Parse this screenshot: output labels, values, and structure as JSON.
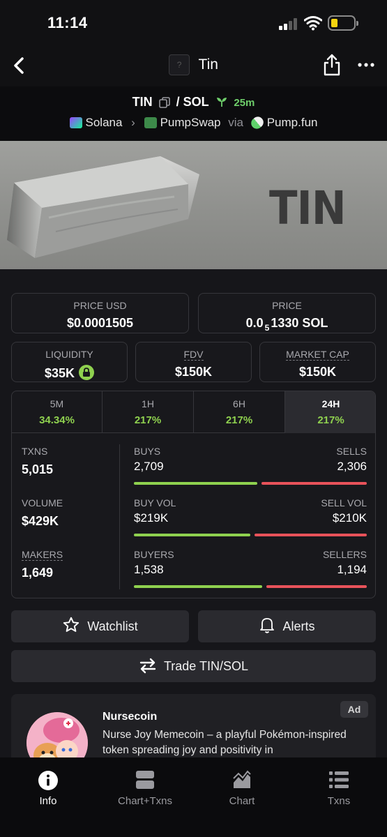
{
  "status_bar": {
    "time": "11:14"
  },
  "nav": {
    "token_icon": "?",
    "title": "Tin"
  },
  "pair": {
    "base": "TIN",
    "separator": "/",
    "quote": "SOL",
    "age": "25m",
    "chain": "Solana",
    "dex": "PumpSwap",
    "via": "via",
    "launchpad": "Pump.fun"
  },
  "banner": {
    "text": "TIN"
  },
  "price_usd": {
    "label": "PRICE USD",
    "value": "$0.0001505"
  },
  "price": {
    "label": "PRICE",
    "prefix": "0.0",
    "zeros": "5",
    "suffix": "1330 SOL"
  },
  "liquidity": {
    "label": "LIQUIDITY",
    "value": "$35K"
  },
  "fdv": {
    "label": "FDV",
    "value": "$150K"
  },
  "market_cap": {
    "label": "MARKET CAP",
    "value": "$150K"
  },
  "timeframes": [
    {
      "label": "5M",
      "change": "34.34%"
    },
    {
      "label": "1H",
      "change": "217%"
    },
    {
      "label": "6H",
      "change": "217%"
    },
    {
      "label": "24H",
      "change": "217%"
    }
  ],
  "active_timeframe": "24H",
  "stats": {
    "txns": {
      "label": "TXNS",
      "value": "5,015"
    },
    "volume": {
      "label": "VOLUME",
      "value": "$429K"
    },
    "makers": {
      "label": "MAKERS",
      "value": "1,649"
    },
    "buys": {
      "left_label": "BUYS",
      "left_value": "2,709",
      "right_label": "SELLS",
      "right_value": "2,306",
      "buy_fraction": 0.54
    },
    "buy_vol": {
      "left_label": "BUY VOL",
      "left_value": "$219K",
      "right_label": "SELL VOL",
      "right_value": "$210K",
      "buy_fraction": 0.51
    },
    "buyers": {
      "left_label": "BUYERS",
      "left_value": "1,538",
      "right_label": "SELLERS",
      "right_value": "1,194",
      "buy_fraction": 0.56
    }
  },
  "buttons": {
    "watchlist": "Watchlist",
    "alerts": "Alerts",
    "trade": "Trade TIN/SOL"
  },
  "ad": {
    "badge": "Ad",
    "name": "Nursecoin",
    "description": "Nurse Joy Memecoin – a playful Pokémon-inspired token spreading joy and positivity in"
  },
  "tabbar": [
    {
      "label": "Info",
      "icon": "info-icon"
    },
    {
      "label": "Chart+Txns",
      "icon": "split-view-icon"
    },
    {
      "label": "Chart",
      "icon": "chart-icon"
    },
    {
      "label": "Txns",
      "icon": "list-icon"
    }
  ],
  "colors": {
    "positive": "#8fd14f",
    "negative": "#e8525a",
    "background": "#16161a"
  }
}
